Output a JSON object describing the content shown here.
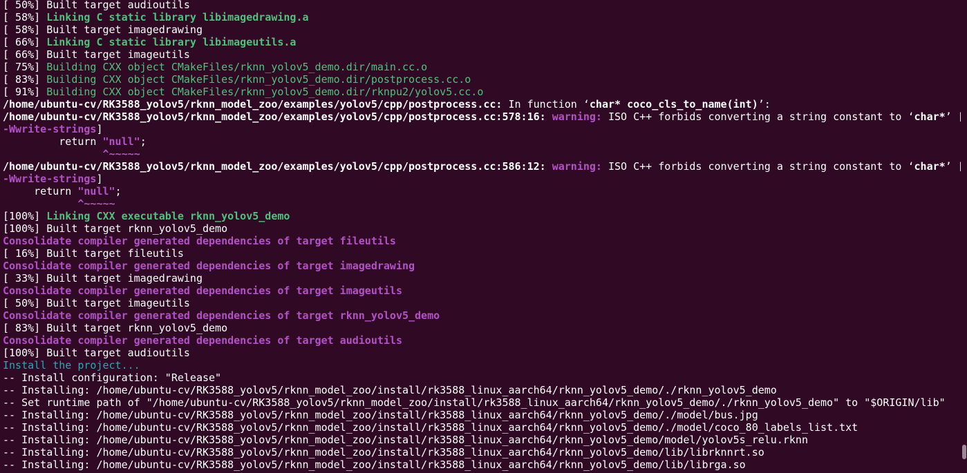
{
  "terminal": {
    "lines": [
      [
        {
          "t": "[ 50%] Built target audioutils",
          "c": "default"
        }
      ],
      [
        {
          "t": "[ 58%] ",
          "c": "default"
        },
        {
          "t": "Linking C static library libimagedrawing.a",
          "c": "green-bold"
        }
      ],
      [
        {
          "t": "[ 58%] Built target imagedrawing",
          "c": "default"
        }
      ],
      [
        {
          "t": "[ 66%] ",
          "c": "default"
        },
        {
          "t": "Linking C static library libimageutils.a",
          "c": "green-bold"
        }
      ],
      [
        {
          "t": "[ 66%] Built target imageutils",
          "c": "default"
        }
      ],
      [
        {
          "t": "[ 75%] ",
          "c": "default"
        },
        {
          "t": "Building CXX object CMakeFiles/rknn_yolov5_demo.dir/main.cc.o",
          "c": "green"
        }
      ],
      [
        {
          "t": "[ 83%] ",
          "c": "default"
        },
        {
          "t": "Building CXX object CMakeFiles/rknn_yolov5_demo.dir/postprocess.cc.o",
          "c": "green"
        }
      ],
      [
        {
          "t": "[ 91%] ",
          "c": "default"
        },
        {
          "t": "Building CXX object CMakeFiles/rknn_yolov5_demo.dir/rknpu2/yolov5.cc.o",
          "c": "green"
        }
      ],
      [
        {
          "t": "/home/ubuntu-cv/RK3588_yolov5/rknn_model_zoo/examples/yolov5/cpp/postprocess.cc:",
          "c": "bold"
        },
        {
          "t": " In function ‘",
          "c": "default"
        },
        {
          "t": "char* coco_cls_to_name(int)",
          "c": "bold"
        },
        {
          "t": "’:",
          "c": "default"
        }
      ],
      [
        {
          "t": "/home/ubuntu-cv/RK3588_yolov5/rknn_model_zoo/examples/yolov5/cpp/postprocess.cc:578:16:",
          "c": "bold"
        },
        {
          "t": " ",
          "c": "default"
        },
        {
          "t": "warning:",
          "c": "magenta-bold"
        },
        {
          "t": " ISO C++ forbids converting a string constant to ‘",
          "c": "default"
        },
        {
          "t": "char*",
          "c": "bold"
        },
        {
          "t": "’ [",
          "c": "default"
        }
      ],
      [
        {
          "t": "-Wwrite-strings",
          "c": "magenta-bold"
        },
        {
          "t": "]",
          "c": "default"
        }
      ],
      [
        {
          "t": "         return ",
          "c": "default"
        },
        {
          "t": "\"null\"",
          "c": "magenta-bold"
        },
        {
          "t": ";",
          "c": "default"
        }
      ],
      [
        {
          "t": "                ",
          "c": "default"
        },
        {
          "t": "^~~~~~",
          "c": "magenta-bold"
        }
      ],
      [
        {
          "t": "/home/ubuntu-cv/RK3588_yolov5/rknn_model_zoo/examples/yolov5/cpp/postprocess.cc:586:12:",
          "c": "bold"
        },
        {
          "t": " ",
          "c": "default"
        },
        {
          "t": "warning:",
          "c": "magenta-bold"
        },
        {
          "t": " ISO C++ forbids converting a string constant to ‘",
          "c": "default"
        },
        {
          "t": "char*",
          "c": "bold"
        },
        {
          "t": "’ [",
          "c": "default"
        }
      ],
      [
        {
          "t": "-Wwrite-strings",
          "c": "magenta-bold"
        },
        {
          "t": "]",
          "c": "default"
        }
      ],
      [
        {
          "t": "     return ",
          "c": "default"
        },
        {
          "t": "\"null\"",
          "c": "magenta-bold"
        },
        {
          "t": ";",
          "c": "default"
        }
      ],
      [
        {
          "t": "            ",
          "c": "default"
        },
        {
          "t": "^~~~~~",
          "c": "magenta-bold"
        }
      ],
      [
        {
          "t": "[100%] ",
          "c": "default"
        },
        {
          "t": "Linking CXX executable rknn_yolov5_demo",
          "c": "green-bold"
        }
      ],
      [
        {
          "t": "[100%] Built target rknn_yolov5_demo",
          "c": "default"
        }
      ],
      [
        {
          "t": "Consolidate compiler generated dependencies of target fileutils",
          "c": "magenta-bold"
        }
      ],
      [
        {
          "t": "[ 16%] Built target fileutils",
          "c": "default"
        }
      ],
      [
        {
          "t": "Consolidate compiler generated dependencies of target imagedrawing",
          "c": "magenta-bold"
        }
      ],
      [
        {
          "t": "[ 33%] Built target imagedrawing",
          "c": "default"
        }
      ],
      [
        {
          "t": "Consolidate compiler generated dependencies of target imageutils",
          "c": "magenta-bold"
        }
      ],
      [
        {
          "t": "[ 50%] Built target imageutils",
          "c": "default"
        }
      ],
      [
        {
          "t": "Consolidate compiler generated dependencies of target rknn_yolov5_demo",
          "c": "magenta-bold"
        }
      ],
      [
        {
          "t": "[ 83%] Built target rknn_yolov5_demo",
          "c": "default"
        }
      ],
      [
        {
          "t": "Consolidate compiler generated dependencies of target audioutils",
          "c": "magenta-bold"
        }
      ],
      [
        {
          "t": "[100%] Built target audioutils",
          "c": "default"
        }
      ],
      [
        {
          "t": "Install the project...",
          "c": "cyan"
        }
      ],
      [
        {
          "t": "-- Install configuration: \"Release\"",
          "c": "default"
        }
      ],
      [
        {
          "t": "-- Installing: /home/ubuntu-cv/RK3588_yolov5/rknn_model_zoo/install/rk3588_linux_aarch64/rknn_yolov5_demo/./rknn_yolov5_demo",
          "c": "default"
        }
      ],
      [
        {
          "t": "-- Set runtime path of \"/home/ubuntu-cv/RK3588_yolov5/rknn_model_zoo/install/rk3588_linux_aarch64/rknn_yolov5_demo/./rknn_yolov5_demo\" to \"$ORIGIN/lib\"",
          "c": "default"
        }
      ],
      [
        {
          "t": "-- Installing: /home/ubuntu-cv/RK3588_yolov5/rknn_model_zoo/install/rk3588_linux_aarch64/rknn_yolov5_demo/./model/bus.jpg",
          "c": "default"
        }
      ],
      [
        {
          "t": "-- Installing: /home/ubuntu-cv/RK3588_yolov5/rknn_model_zoo/install/rk3588_linux_aarch64/rknn_yolov5_demo/./model/coco_80_labels_list.txt",
          "c": "default"
        }
      ],
      [
        {
          "t": "-- Installing: /home/ubuntu-cv/RK3588_yolov5/rknn_model_zoo/install/rk3588_linux_aarch64/rknn_yolov5_demo/model/yolov5s_relu.rknn",
          "c": "default"
        }
      ],
      [
        {
          "t": "-- Installing: /home/ubuntu-cv/RK3588_yolov5/rknn_model_zoo/install/rk3588_linux_aarch64/rknn_yolov5_demo/lib/librknnrt.so",
          "c": "default"
        }
      ],
      [
        {
          "t": "-- Installing: /home/ubuntu-cv/RK3588_yolov5/rknn_model_zoo/install/rk3588_linux_aarch64/rknn_yolov5_demo/lib/librga.so",
          "c": "default"
        }
      ]
    ]
  },
  "scrollbar": {
    "position_fraction": 0.97,
    "visible_fraction": 0.03
  },
  "colors": {
    "background": "#300a24",
    "default": "#ffffff",
    "green": "#4ec27b",
    "magenta": "#b450c8",
    "cyan": "#2aa7b8",
    "scroll_thumb": "#9b8a96"
  }
}
